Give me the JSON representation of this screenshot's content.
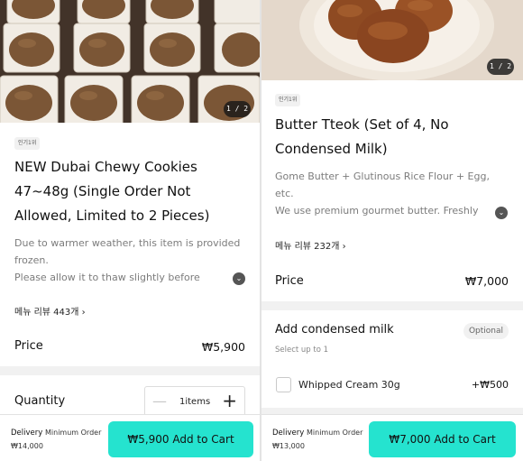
{
  "left": {
    "image_counter": "1 / 2",
    "badge": "인기1위",
    "title_lines": [
      "NEW Dubai Chewy Cookies",
      "47~48g (Single Order Not",
      "Allowed, Limited to 2 Pieces)"
    ],
    "description_lines": [
      "Due to warmer weather, this item is provided",
      "frozen.",
      "Please allow it to thaw slightly before"
    ],
    "reviews": "메뉴 리뷰 443개 ›",
    "price_label": "Price",
    "price_value": "₩5,900",
    "quantity_label": "Quantity",
    "quantity_value": "1items",
    "delivery_label": "Delivery",
    "minimum_order_label": "Minimum Order",
    "minimum_order_value": "₩14,000",
    "add_to_cart": "₩5,900 Add to Cart"
  },
  "right": {
    "image_counter": "1 / 2",
    "badge": "인기1위",
    "title_lines": [
      "Butter Tteok (Set of 4, No",
      "Condensed Milk)"
    ],
    "description_lines": [
      "Gome Butter + Glutinous Rice Flour + Egg,",
      "etc.",
      "We use premium gourmet butter. Freshly"
    ],
    "reviews": "메뉴 리뷰 232개 ›",
    "price_label": "Price",
    "price_value": "₩7,000",
    "option_group": {
      "title": "Add condensed milk",
      "badge": "Optional",
      "subtitle": "Select up to 1",
      "options": [
        {
          "name": "Whipped Cream 30g",
          "price": "+₩500"
        }
      ]
    },
    "delivery_label": "Delivery",
    "minimum_order_label": "Minimum Order",
    "minimum_order_value": "₩13,000",
    "add_to_cart": "₩7,000 Add to Cart"
  },
  "colors": {
    "accent": "#25e3cf"
  },
  "icons": {
    "expand": "chevron-down-icon",
    "plus": "plus-icon",
    "minus": "minus-icon"
  }
}
